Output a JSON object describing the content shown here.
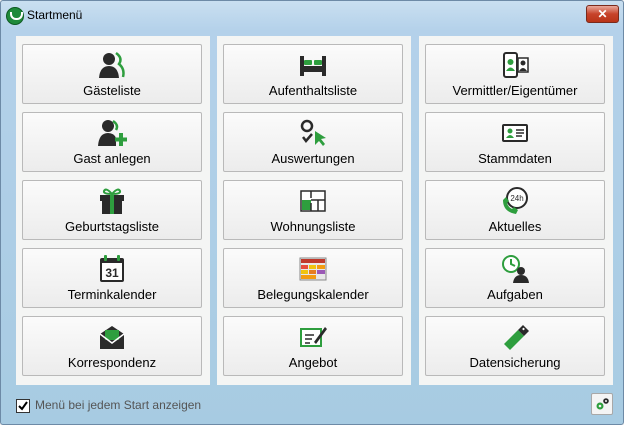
{
  "window": {
    "title": "Startmenü",
    "close_label": "✕"
  },
  "columns": [
    {
      "tiles": [
        {
          "label": "Gästeliste",
          "icon": "guests-icon"
        },
        {
          "label": "Gast anlegen",
          "icon": "add-guest-icon"
        },
        {
          "label": "Geburtstagsliste",
          "icon": "gift-icon"
        },
        {
          "label": "Terminkalender",
          "icon": "calendar-31-icon"
        },
        {
          "label": "Korrespondenz",
          "icon": "envelope-icon"
        }
      ]
    },
    {
      "tiles": [
        {
          "label": "Aufenthaltsliste",
          "icon": "bed-icon"
        },
        {
          "label": "Auswertungen",
          "icon": "evaluation-icon"
        },
        {
          "label": "Wohnungsliste",
          "icon": "floorplan-icon"
        },
        {
          "label": "Belegungskalender",
          "icon": "occupancy-calendar-icon"
        },
        {
          "label": "Angebot",
          "icon": "offer-icon"
        }
      ]
    },
    {
      "tiles": [
        {
          "label": "Vermittler/Eigentümer",
          "icon": "agent-owner-icon"
        },
        {
          "label": "Stammdaten",
          "icon": "id-card-icon"
        },
        {
          "label": "Aktuelles",
          "icon": "phone-24h-icon"
        },
        {
          "label": "Aufgaben",
          "icon": "tasks-icon"
        },
        {
          "label": "Datensicherung",
          "icon": "usb-backup-icon"
        }
      ]
    }
  ],
  "footer": {
    "show_on_start_label": "Menü bei jedem Start anzeigen",
    "show_on_start_checked": true
  },
  "colors": {
    "accent_green": "#2e9e3e",
    "dark": "#2a2a2a"
  }
}
